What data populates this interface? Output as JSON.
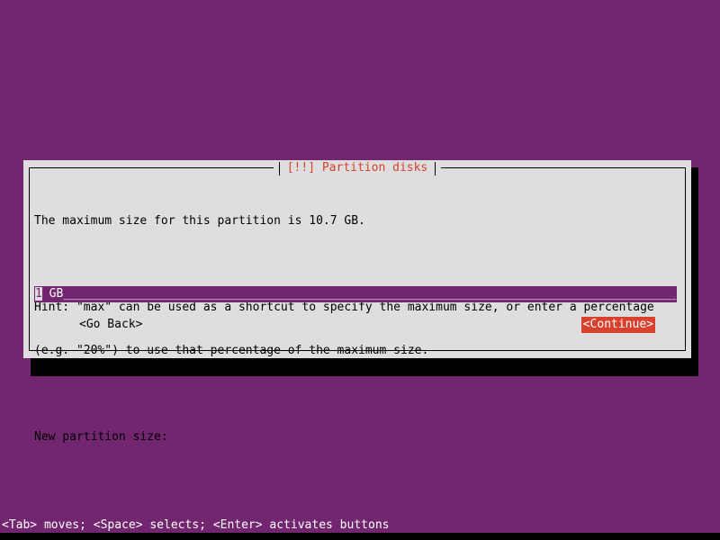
{
  "screen": {
    "background_color": "#72266f",
    "accent_red": "#d8412e",
    "dialog_background": "#dedede",
    "field_background": "#72266f"
  },
  "dialog": {
    "title_prefix": "[!!]",
    "title": "[!!] Partition disks",
    "paragraphs": {
      "line1": "The maximum size for this partition is 10.7 GB.",
      "line2": "",
      "line3": "Hint: \"max\" can be used as a shortcut to specify the maximum size, or enter a percentage",
      "line4": "(e.g. \"20%\") to use that percentage of the maximum size.",
      "line5": "",
      "prompt_label": "New partition size:"
    },
    "input": {
      "value": "1 GB",
      "caret_char": "1",
      "rest": " GB",
      "fill_char": "_",
      "fill": "_______________________________________________________________________________________"
    },
    "buttons": {
      "go_back": "<Go Back>",
      "continue": "<Continue>",
      "focused": "continue"
    }
  },
  "statusbar": {
    "text": "<Tab> moves; <Space> selects; <Enter> activates buttons"
  }
}
